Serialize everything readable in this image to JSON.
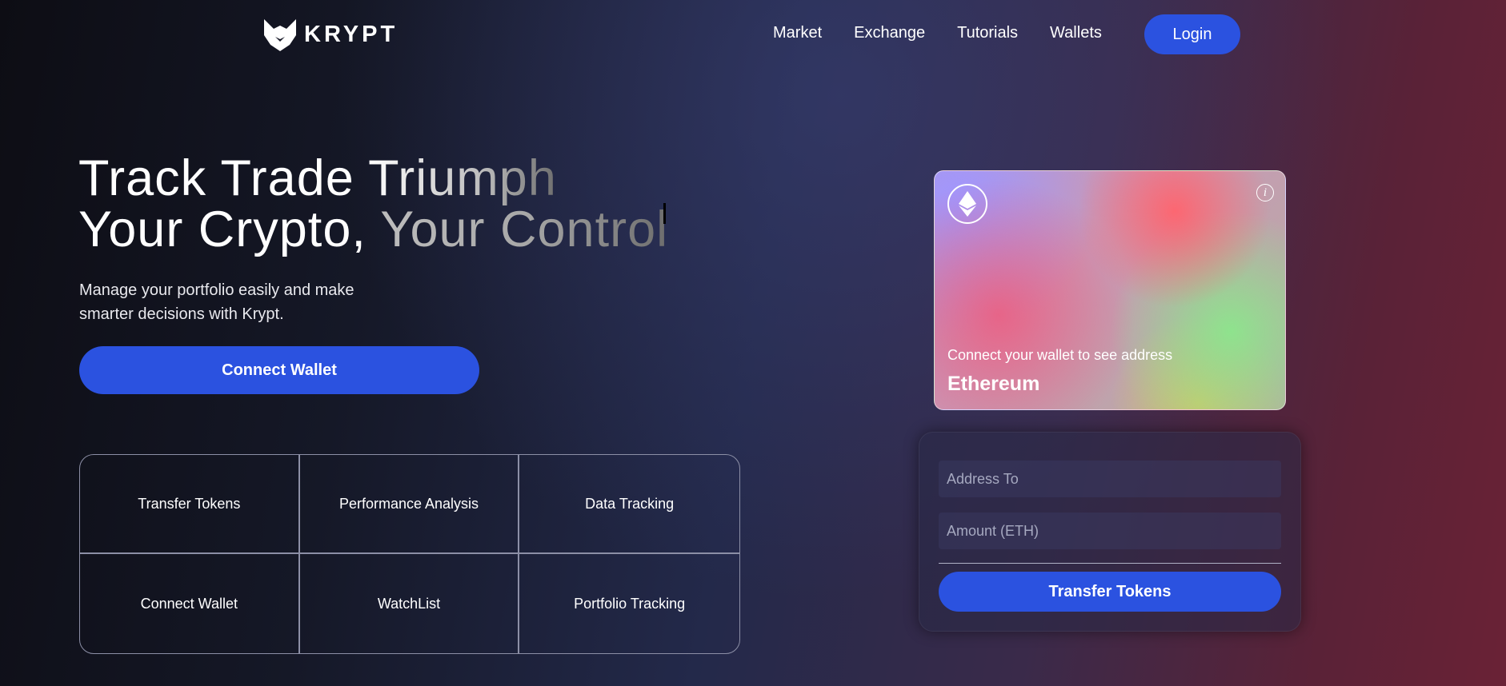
{
  "brand": {
    "name": "KRYPT"
  },
  "nav": {
    "links": [
      "Market",
      "Exchange",
      "Tutorials",
      "Wallets"
    ],
    "login_label": "Login"
  },
  "hero": {
    "title_line1_a": "Track Trade ",
    "title_line1_b": "Triumph",
    "title_line2_a": "Your Crypto, ",
    "title_line2_b": "Your Control",
    "description": "Manage your portfolio easily and make smarter decisions with Krypt.",
    "connect_label": "Connect Wallet"
  },
  "features": [
    "Transfer Tokens",
    "Performance Analysis",
    "Data Tracking",
    "Connect Wallet",
    "WatchList",
    "Portfolio Tracking"
  ],
  "eth_card": {
    "address_text": "Connect your wallet to see address",
    "network": "Ethereum",
    "icon": "ethereum-icon",
    "info_icon": "info-icon"
  },
  "transfer_form": {
    "address_placeholder": "Address To",
    "amount_placeholder": "Amount (ETH)",
    "submit_label": "Transfer Tokens"
  },
  "colors": {
    "accent": "#2b52e0",
    "background_left": "#0d0d14",
    "background_right": "#6a2236"
  }
}
